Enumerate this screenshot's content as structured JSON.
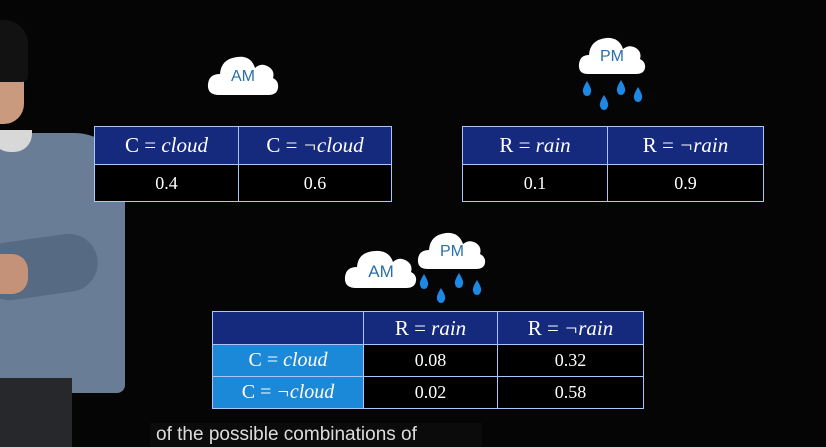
{
  "clouds": {
    "am_top": "AM",
    "pm_top": "PM",
    "am_bottom": "AM",
    "pm_bottom": "PM"
  },
  "cloud_table": {
    "headers": [
      {
        "var": "C",
        "eq": " = ",
        "val": "cloud"
      },
      {
        "var": "C",
        "eq": " = ",
        "val": "¬cloud"
      }
    ],
    "values": [
      "0.4",
      "0.6"
    ]
  },
  "rain_table": {
    "headers": [
      {
        "var": "R",
        "eq": " = ",
        "val": "rain"
      },
      {
        "var": "R",
        "eq": " = ",
        "val": "¬rain"
      }
    ],
    "values": [
      "0.1",
      "0.9"
    ]
  },
  "joint_table": {
    "col_headers": [
      {
        "var": "R",
        "eq": " = ",
        "val": "rain"
      },
      {
        "var": "R",
        "eq": " = ",
        "val": "¬rain"
      }
    ],
    "rows": [
      {
        "label": {
          "var": "C",
          "eq": " = ",
          "val": "cloud"
        },
        "values": [
          "0.08",
          "0.32"
        ]
      },
      {
        "label": {
          "var": "C",
          "eq": " = ",
          "val": "¬cloud"
        },
        "values": [
          "0.02",
          "0.58"
        ]
      }
    ]
  },
  "caption": "of the possible combinations of",
  "colors": {
    "header_bg": "#162a7d",
    "row_header_bg": "#1b88d8",
    "border": "#a6c8ff",
    "cloud_text": "#2a6fa8",
    "rain_drop": "#1e88e5"
  }
}
